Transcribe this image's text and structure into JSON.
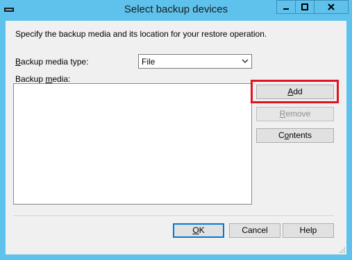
{
  "window": {
    "title": "Select backup devices",
    "controls": {
      "minimize": "minimize",
      "maximize": "maximize",
      "close": "close"
    }
  },
  "dialog": {
    "description": "Specify the backup media and its location for your restore operation.",
    "media_type_label": "Backup media type:",
    "media_type_value": "File",
    "media_label": "Backup media:",
    "media_items": []
  },
  "buttons": {
    "add": "Add",
    "remove": "Remove",
    "contents": "Contents",
    "ok": "OK",
    "cancel": "Cancel",
    "help": "Help"
  },
  "accent": {
    "titlebar": "#5fc2ec",
    "highlight": "#e0141e"
  },
  "icons": [
    "window-system-icon",
    "minimize-icon",
    "maximize-icon",
    "close-icon",
    "chevron-down-icon",
    "resize-grip-icon"
  ]
}
